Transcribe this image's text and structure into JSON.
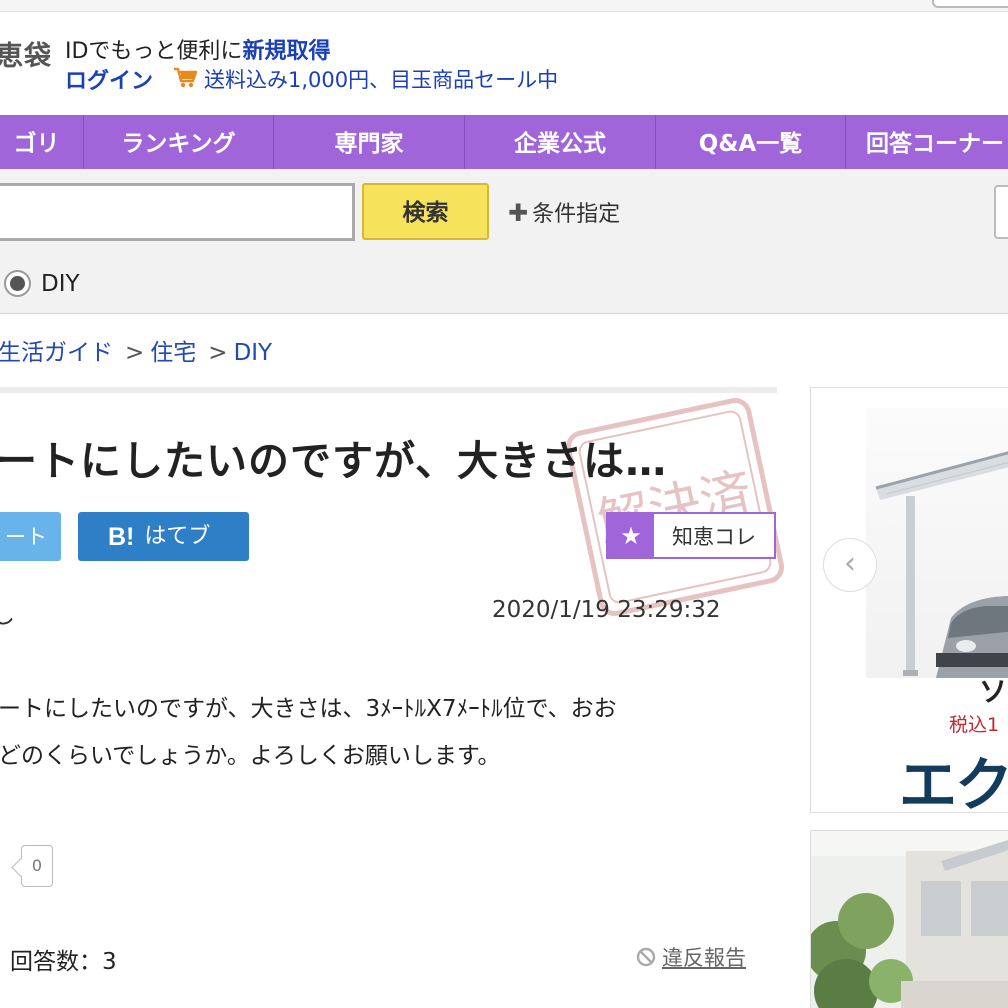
{
  "header": {
    "logo_fragment": "恵袋",
    "promo_text": "IDでもっと便利に",
    "register_link": "新規取得",
    "login_link": "ログイン",
    "cart_icon": "cart-icon",
    "shipping_promo": "送料込み1,000円、目玉商品セール中"
  },
  "nav": {
    "items": [
      {
        "label": "ゴリ"
      },
      {
        "label": "ランキング"
      },
      {
        "label": "専門家"
      },
      {
        "label": "企業公式"
      },
      {
        "label": "Q&A一覧"
      },
      {
        "label": "回答コーナー"
      }
    ]
  },
  "search": {
    "input_value": "",
    "button_label": "検索",
    "condition_label": "条件指定",
    "radio_label": "DIY"
  },
  "breadcrumb": {
    "items": [
      "生活ガイド",
      "住宅",
      "DIY"
    ],
    "separator": ">"
  },
  "question": {
    "title": "ートにしたいのですが、大きさは…",
    "tweet_label": "ート",
    "hatebu_icon": "B!",
    "hatebu_label": "はてブ",
    "chie_collection_label": "知恵コレ",
    "user_fragment": "し",
    "posted_at": "2020/1/19  23:29:32",
    "body_line1": "ートにしたいのですが、大きさは、3ﾒｰﾄﾙX7ﾒｰﾄﾙ位で、おお",
    "body_line2": "どのくらいでしょうか。よろしくお願いします。",
    "like_count": "0",
    "answers_label": "回答数：3",
    "report_label": "違反報告",
    "stamp_text": "解決済"
  },
  "ads": {
    "ad1": {
      "name_fragment": "ソ",
      "price_fragment": "税込1",
      "brand_fragment": "エクス"
    }
  },
  "colors": {
    "nav_bg": "#a065d8",
    "link": "#1a3fb8",
    "search_button": "#f7e25c",
    "hatebu": "#2f7fc7",
    "tweet": "#68b4ea",
    "price": "#c4272c"
  }
}
